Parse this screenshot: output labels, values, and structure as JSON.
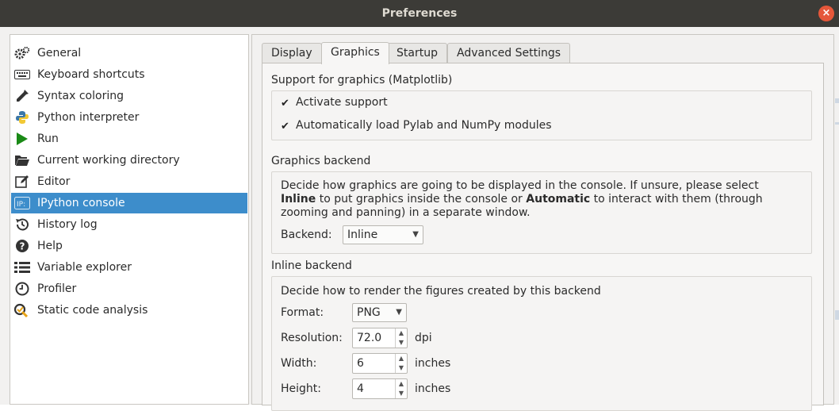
{
  "window": {
    "title": "Preferences",
    "close_symbol": "×"
  },
  "sidebar": {
    "items": [
      {
        "label": "General",
        "icon": "gears-icon"
      },
      {
        "label": "Keyboard shortcuts",
        "icon": "keyboard-icon"
      },
      {
        "label": "Syntax coloring",
        "icon": "dropper-icon"
      },
      {
        "label": "Python interpreter",
        "icon": "python-icon"
      },
      {
        "label": "Run",
        "icon": "play-icon"
      },
      {
        "label": "Current working directory",
        "icon": "folder-open-icon"
      },
      {
        "label": "Editor",
        "icon": "edit-icon"
      },
      {
        "label": "IPython console",
        "icon": "ipython-icon",
        "selected": true
      },
      {
        "label": "History log",
        "icon": "history-icon"
      },
      {
        "label": "Help",
        "icon": "help-icon"
      },
      {
        "label": "Variable explorer",
        "icon": "list-icon"
      },
      {
        "label": "Profiler",
        "icon": "clock-icon"
      },
      {
        "label": "Static code analysis",
        "icon": "analysis-icon"
      }
    ],
    "selected_color": "#3d8dcb"
  },
  "tabs": [
    {
      "label": "Display"
    },
    {
      "label": "Graphics",
      "active": true
    },
    {
      "label": "Startup"
    },
    {
      "label": "Advanced Settings"
    }
  ],
  "graphics": {
    "support_title": "Support for graphics (Matplotlib)",
    "activate_support": {
      "label": "Activate support",
      "checked": true
    },
    "autoload_pylab": {
      "label": "Automatically load Pylab and NumPy modules",
      "checked": true
    },
    "backend_title": "Graphics backend",
    "backend_desc_1": "Decide how graphics are going to be displayed in the console. If unsure, please select ",
    "backend_desc_bold_1": "Inline",
    "backend_desc_2": " to put graphics inside the console or ",
    "backend_desc_bold_2": "Automatic",
    "backend_desc_3": " to interact with them (through zooming and panning) in a separate window.",
    "backend_label": "Backend:",
    "backend_value": "Inline",
    "inline_title": "Inline backend",
    "inline_desc": "Decide how to render the figures created by this backend",
    "format_label": "Format:",
    "format_value": "PNG",
    "resolution_label": "Resolution:",
    "resolution_value": "72.0",
    "resolution_unit": "dpi",
    "width_label": "Width:",
    "width_value": "6",
    "width_unit": "inches",
    "height_label": "Height:",
    "height_value": "4",
    "height_unit": "inches"
  }
}
